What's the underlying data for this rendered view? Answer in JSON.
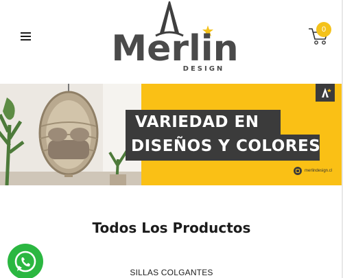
{
  "header": {
    "logo_wordmark": "Merlin",
    "logo_subtitle": "DESIGN",
    "cart_count": "0"
  },
  "banner": {
    "line1": "VARIEDAD EN",
    "line2": "DISEÑOS Y COLORES",
    "instagram_handle": "merlindesign.cl"
  },
  "main": {
    "section_title": "Todos Los Productos",
    "category_label": "SILLAS COLGANTES"
  },
  "colors": {
    "brand_yellow": "#fac015",
    "badge_yellow": "#f4c21b",
    "dark_gray": "#3b3b3b",
    "whatsapp_green": "#2bb741"
  },
  "icons": [
    "hamburger-menu-icon",
    "cart-icon",
    "instagram-icon",
    "whatsapp-icon",
    "star-icon"
  ]
}
